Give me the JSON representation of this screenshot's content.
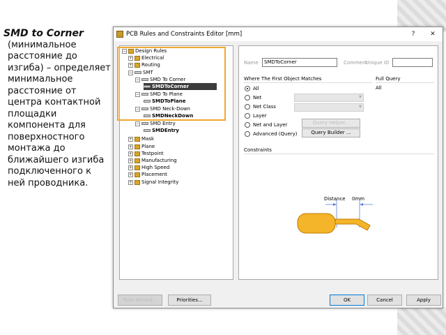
{
  "slide": {
    "title": "SMD to Corner",
    "description": "(минимальное расстояние до изгиба) – определяет минимальное расстояние от центра контактной площадки компонента для поверхностного монтажа до ближайшего изгиба подключенного к ней проводника."
  },
  "window": {
    "title": "PCB Rules and Constraints Editor [mm]",
    "help_label": "?",
    "close_label": "✕"
  },
  "tree": {
    "items": [
      {
        "label": "Design Rules",
        "expander": "−"
      },
      {
        "label": "Electrical",
        "expander": "+"
      },
      {
        "label": "Routing",
        "expander": "+"
      },
      {
        "label": "SMT",
        "expander": "−"
      },
      {
        "label": "SMD To Corner",
        "expander": "−"
      },
      {
        "label": "SMDToCorner"
      },
      {
        "label": "SMD To Plane",
        "expander": "−"
      },
      {
        "label": "SMDToPlane"
      },
      {
        "label": "SMD Neck-Down",
        "expander": "−"
      },
      {
        "label": "SMDNeckDown"
      },
      {
        "label": "SMD Entry",
        "expander": "−"
      },
      {
        "label": "SMDEntry"
      },
      {
        "label": "Mask",
        "expander": "+"
      },
      {
        "label": "Plane",
        "expander": "+"
      },
      {
        "label": "Testpoint",
        "expander": "+"
      },
      {
        "label": "Manufacturing",
        "expander": "+"
      },
      {
        "label": "High Speed",
        "expander": "+"
      },
      {
        "label": "Placement",
        "expander": "+"
      },
      {
        "label": "Signal Integrity",
        "expander": "+"
      }
    ]
  },
  "rule": {
    "name_label": "Name",
    "name_value": "SMDToCorner",
    "comment_label": "Comment",
    "uniqueid_label": "Unique ID",
    "comment_value": "",
    "uniqueid_value": ""
  },
  "match": {
    "header": "Where The First Object Matches",
    "options": [
      "All",
      "Net",
      "Net Class",
      "Layer",
      "Net and Layer",
      "Advanced (Query)"
    ],
    "query_helper_label": "Query Helper...",
    "query_builder_label": "Query Builder ..."
  },
  "full_query": {
    "header": "Full Query",
    "value": "All"
  },
  "constraints": {
    "header": "Constraints",
    "distance_label": "Distance",
    "distance_value": "0mm",
    "colors": {
      "pad_fill": "#f5b52a",
      "pad_stroke": "#c07a00",
      "dimension": "#5b7fd6"
    }
  },
  "buttons": {
    "rule_wizard": "Rule Wizard...",
    "priorities": "Priorities...",
    "ok": "OK",
    "cancel": "Cancel",
    "apply": "Apply"
  }
}
